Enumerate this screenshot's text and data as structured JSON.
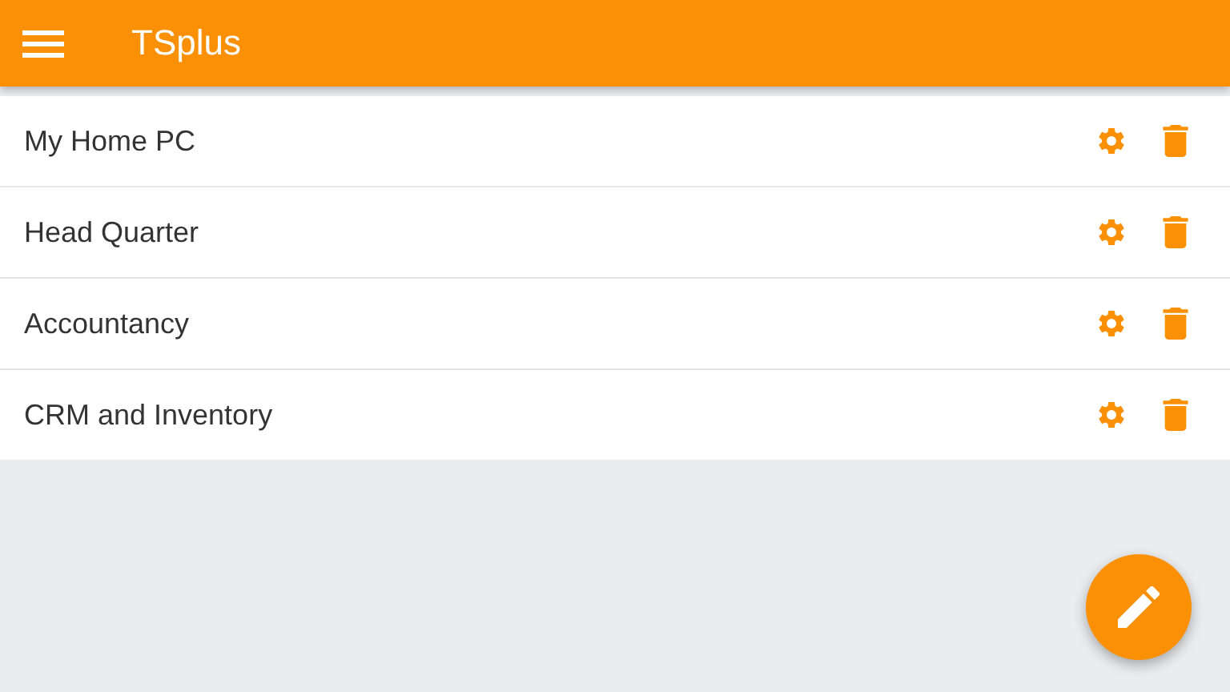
{
  "app_bar": {
    "title": "TSplus"
  },
  "connections": [
    {
      "name": "My Home PC"
    },
    {
      "name": "Head Quarter"
    },
    {
      "name": "Accountancy"
    },
    {
      "name": "CRM and Inventory"
    }
  ]
}
